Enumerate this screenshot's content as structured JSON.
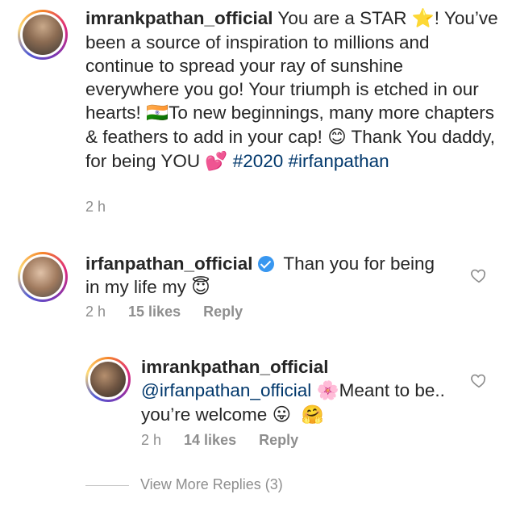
{
  "comments": [
    {
      "username": "imrankpathan_official",
      "text_a": " You are a STAR ",
      "emoji_star": "⭐",
      "text_b": "! You’ve been a source of inspiration to millions and continue to spread your ray of sunshine everywhere you go! Your triumph is etched in our hearts! ",
      "emoji_flag": "🇮🇳",
      "text_c": "To new beginnings, many more chapters & feathers to add in your cap! ",
      "emoji_smile": "😊",
      "text_d": " Thank You daddy, for being YOU ",
      "emoji_hearts": "💕",
      "hashtag1": "#2020",
      "hashtag2": "#irfanpathan",
      "time": "2 h"
    },
    {
      "username": "irfanpathan_official",
      "text_a": " Than you for being in my life my ",
      "emoji_halo": "😇",
      "time": "2 h",
      "likes": "15 likes",
      "reply": "Reply"
    },
    {
      "username": "imrankpathan_official",
      "mention": "@irfanpathan_official",
      "emoji_blossom": "🌸",
      "text_a": "Meant to be.. you’re welcome ",
      "emoji_tongue": "😛",
      "emoji_hug": "🤗",
      "time": "2 h",
      "likes": "14 likes",
      "reply": "Reply"
    }
  ],
  "view_more": "View More Replies (3)",
  "colors": {
    "text": "#262626",
    "muted": "#8e8e8e",
    "link": "#00376b",
    "verified": "#3897f0"
  },
  "icons": [
    "verified-badge-icon",
    "like-heart-icon"
  ]
}
